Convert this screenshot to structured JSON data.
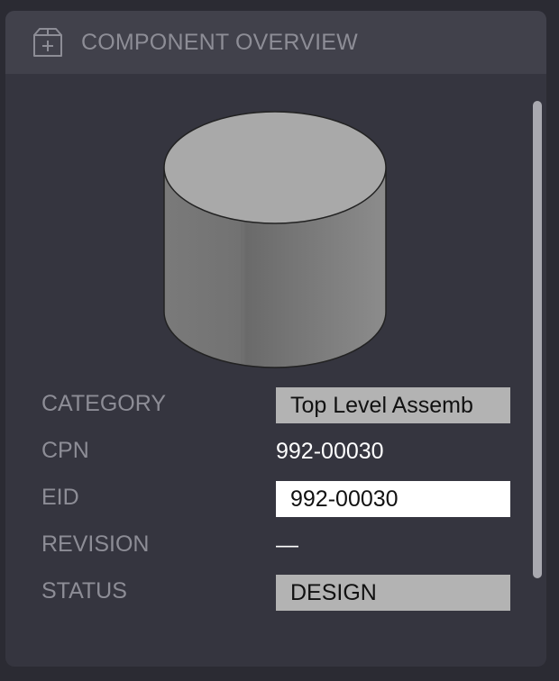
{
  "header": {
    "title": "COMPONENT OVERVIEW",
    "icon": "box-plus-icon"
  },
  "thumbnail": {
    "icon": "cylinder-part-icon"
  },
  "fields": {
    "category": {
      "label": "CATEGORY",
      "value": "Top Level Assemb"
    },
    "cpn": {
      "label": "CPN",
      "value": "992-00030"
    },
    "eid": {
      "label": "EID",
      "value": "992-00030"
    },
    "revision": {
      "label": "REVISION",
      "value": "—"
    },
    "status": {
      "label": "STATUS",
      "value": "DESIGN"
    }
  },
  "colors": {
    "background": "#2b2b33",
    "panel": "#35353f",
    "header": "#41414b",
    "label": "#8d8d96",
    "value_box_grey": "#b3b3b3",
    "value_box_white": "#ffffff"
  }
}
